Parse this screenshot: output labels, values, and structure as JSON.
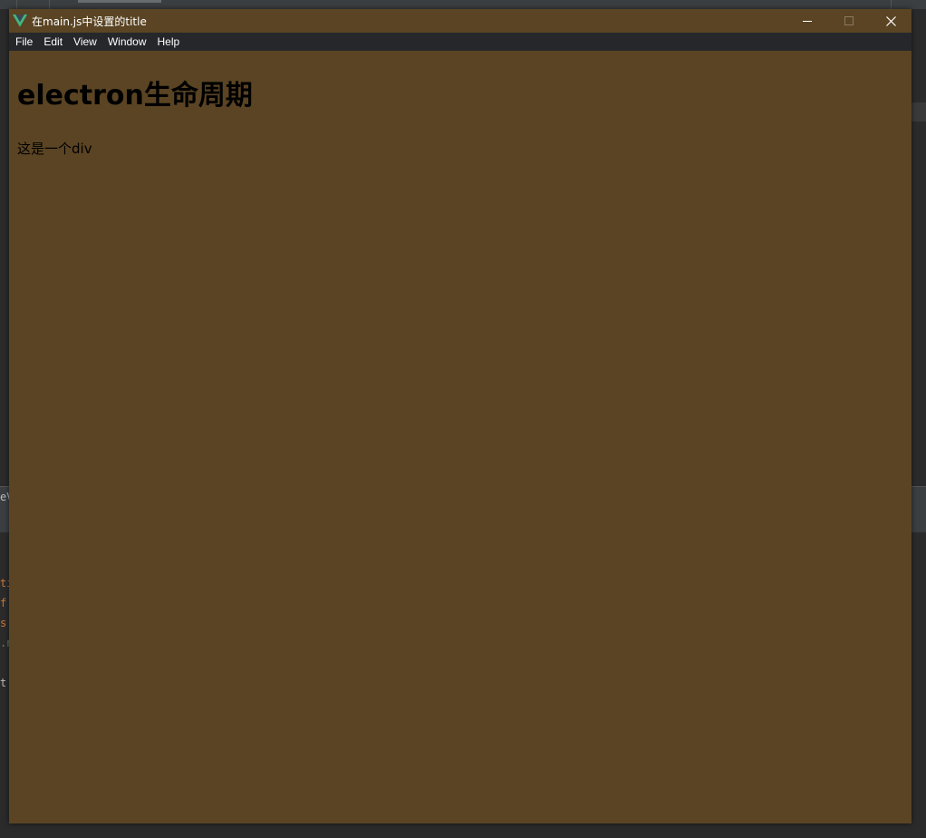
{
  "window": {
    "title": "在main.js中设置的title",
    "app_icon": "vue-logo-icon",
    "controls": {
      "minimize_icon": "minimize-icon",
      "maximize_icon": "maximize-icon",
      "close_icon": "close-icon"
    }
  },
  "menubar": {
    "items": [
      "File",
      "Edit",
      "View",
      "Window",
      "Help"
    ]
  },
  "content": {
    "heading": "electron生命周期",
    "paragraph": "这是一个div"
  },
  "background_ide": {
    "left_fragments": [
      "eV",
      "ti",
      "f.",
      "s:",
      ".n",
      "t"
    ]
  },
  "colors": {
    "window_background": "#5a4423",
    "menubar_background": "#25272b",
    "text": "#000000",
    "vue_green": "#41b883",
    "vue_dark": "#35495e"
  }
}
